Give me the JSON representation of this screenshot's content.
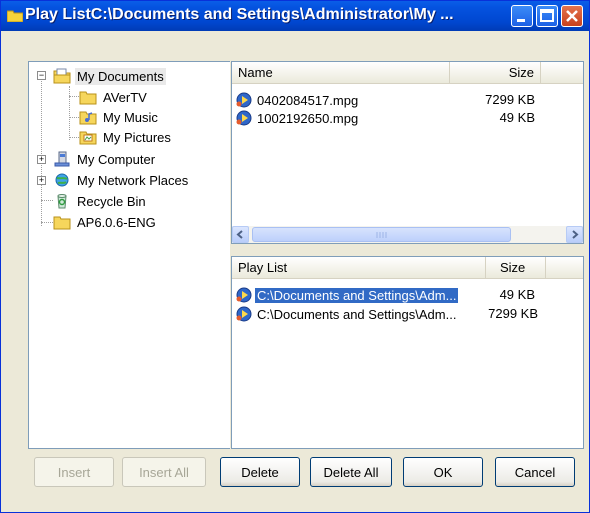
{
  "window": {
    "title": "Play ListC:\\Documents and Settings\\Administrator\\My ...",
    "controls": [
      "minimize-icon",
      "maximize-icon",
      "close-icon"
    ]
  },
  "tree": {
    "items": [
      {
        "label": "My Documents",
        "icon": "documents-folder-icon",
        "expander": "−"
      },
      {
        "label": "AVerTV",
        "icon": "folder-icon"
      },
      {
        "label": "My Music",
        "icon": "music-folder-icon"
      },
      {
        "label": "My Pictures",
        "icon": "pictures-folder-icon"
      },
      {
        "label": "My Computer",
        "icon": "computer-icon",
        "expander": "+"
      },
      {
        "label": "My Network Places",
        "icon": "network-icon",
        "expander": "+"
      },
      {
        "label": "Recycle Bin",
        "icon": "recycle-bin-icon"
      },
      {
        "label": "AP6.0.6-ENG",
        "icon": "folder-icon"
      }
    ]
  },
  "files": {
    "columns": {
      "name": "Name",
      "size": "Size"
    },
    "rows": [
      {
        "name": "0402084517.mpg",
        "size": "7299 KB",
        "icon": "media-file-icon"
      },
      {
        "name": "1002192650.mpg",
        "size": "49 KB",
        "icon": "media-file-icon"
      }
    ]
  },
  "playlist": {
    "columns": {
      "name": "Play List",
      "size": "Size"
    },
    "rows": [
      {
        "name": "C:\\Documents and Settings\\Adm...",
        "size": "49 KB",
        "icon": "media-file-icon",
        "selected": true
      },
      {
        "name": "C:\\Documents and Settings\\Adm...",
        "size": "7299 KB",
        "icon": "media-file-icon",
        "selected": false
      }
    ]
  },
  "buttons": {
    "insert": "Insert",
    "insert_all": "Insert All",
    "delete": "Delete",
    "delete_all": "Delete All",
    "ok": "OK",
    "cancel": "Cancel"
  },
  "colors": {
    "titlebar": "#0054e3",
    "selection": "#316ac5",
    "face": "#ece9d8"
  }
}
